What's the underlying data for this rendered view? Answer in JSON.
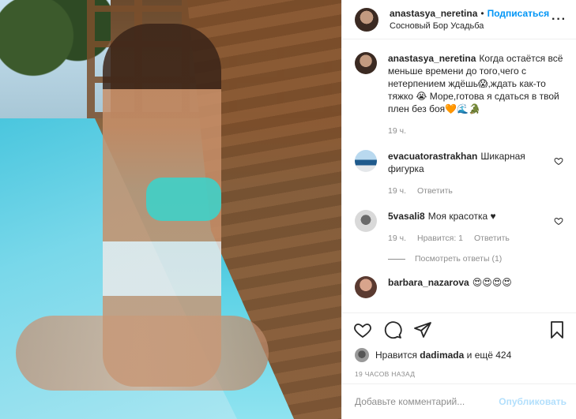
{
  "post": {
    "author": "anastasya_neretina",
    "follow_label": "Подписаться",
    "location": "Сосновый Бор Усадьба",
    "more_icon": "more-options-icon",
    "separator": "•"
  },
  "caption": {
    "author": "anastasya_neretina",
    "text": "Когда остаётся всё меньше времени до того,чего с нетерпением ждёшь😱,ждать как-то тяжко 😭 Море,готова я сдаться в твой плен без боя🧡🌊🐊",
    "time": "19 ч."
  },
  "comments": [
    {
      "author": "evacuatorastrakhan",
      "text": "Шикарная фигурка",
      "time": "19 ч.",
      "reply_label": "Ответить"
    },
    {
      "author": "5vasali8",
      "text": "Моя красотка ♥",
      "time": "19 ч.",
      "likes_label": "Нравится: 1",
      "reply_label": "Ответить",
      "view_replies": "Посмотреть ответы (1)"
    },
    {
      "author": "barbara_nazarova",
      "text": "😍😍😍😍"
    }
  ],
  "actions": {
    "like_icon": "heart-icon",
    "comment_icon": "comment-icon",
    "share_icon": "share-icon",
    "save_icon": "bookmark-icon"
  },
  "likes": {
    "prefix": "Нравится",
    "user": "dadimada",
    "suffix": "и ещё 424"
  },
  "timestamp": "19 ЧАСОВ НАЗАД",
  "add_comment": {
    "placeholder": "Добавьте комментарий...",
    "publish_label": "Опубликовать"
  },
  "colors": {
    "accent": "#0095f6",
    "publish_disabled": "#b2dffc",
    "muted": "#8e8e8e"
  }
}
